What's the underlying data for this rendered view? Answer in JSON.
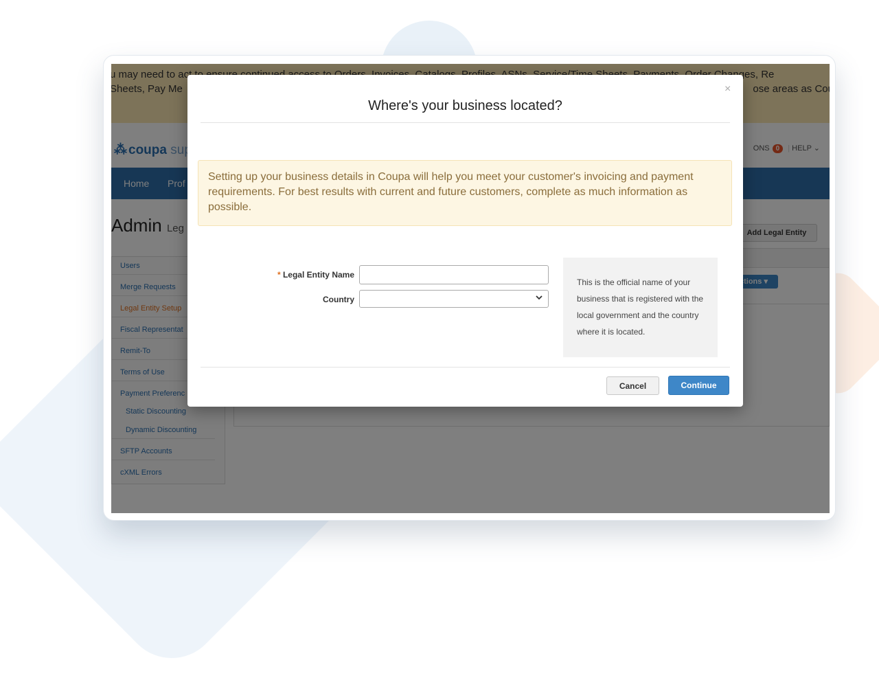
{
  "banner": {
    "line1_left": "u may need to act to ensure continued access to Orders, Invoices, Catalogs, Profiles, ASNs, Service/Time Sheets, Payments, Order Changes, Re",
    "line2_left": "Sheets, Pay Me",
    "line2_right": "ose areas as Cou"
  },
  "header": {
    "logo_text": "coupa",
    "logo_suffix": "sup",
    "notifications_label": "ONS",
    "notifications_count": "0",
    "separator": "|",
    "help_label": "HELP",
    "help_chevron": "⌄"
  },
  "nav": {
    "items": [
      "Home",
      "Prof"
    ]
  },
  "page": {
    "title": "Admin",
    "subtitle": "Leg",
    "add_button": "Add Legal Entity",
    "actions_button": "ctions",
    "actions_chevron": "▾"
  },
  "sidebar": {
    "items": [
      "Users",
      "Merge Requests",
      "Legal Entity Setup",
      "Fiscal Representat",
      "Remit-To",
      "Terms of Use",
      "Payment Preferenc",
      "Static Discounting",
      "Dynamic Discounting",
      "SFTP Accounts",
      "cXML Errors"
    ]
  },
  "modal": {
    "close": "×",
    "title": "Where's your business located?",
    "info_text": "Setting up your business details in Coupa will help you meet your customer's invoicing and payment requirements. For best results with current and future customers, complete as much information as possible.",
    "required_mark": "*",
    "legal_entity_label": "Legal Entity Name",
    "legal_entity_value": "",
    "country_label": "Country",
    "country_value": "",
    "help_text": "This is the official name of your business that is registered with the local government and the country where it is located.",
    "cancel_label": "Cancel",
    "continue_label": "Continue"
  }
}
